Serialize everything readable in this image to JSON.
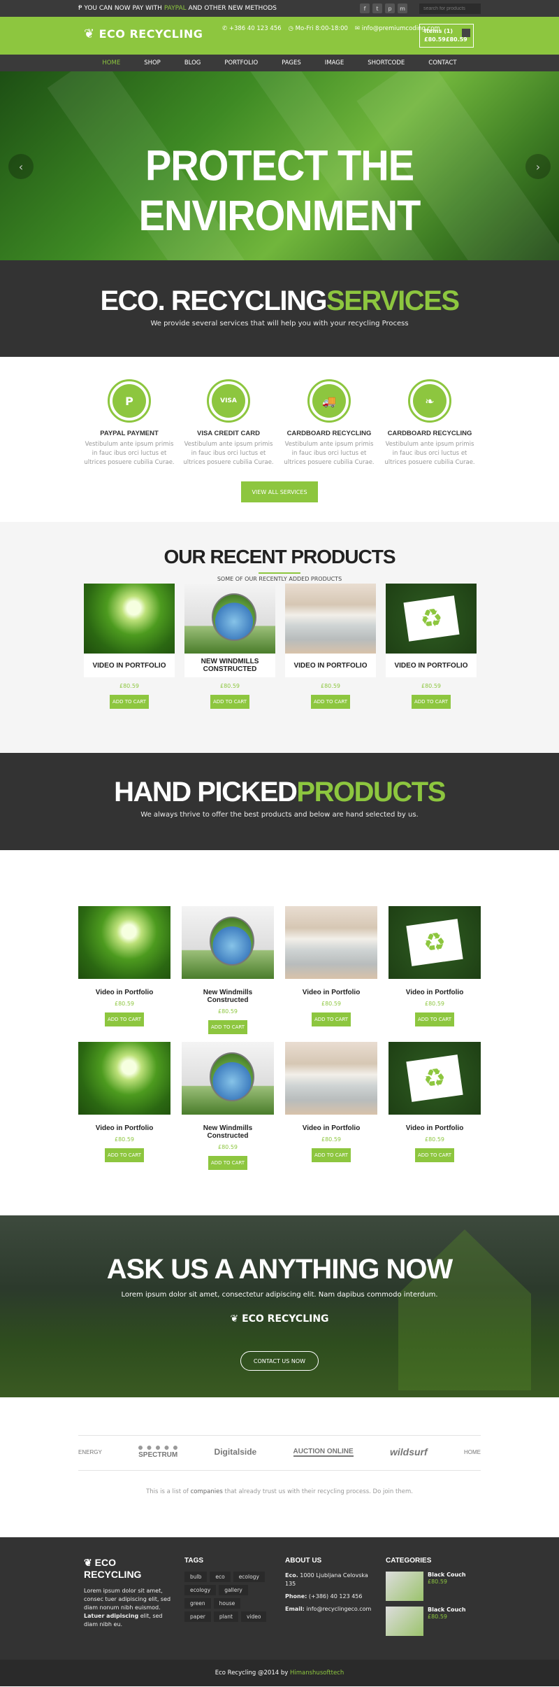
{
  "topbar": {
    "promo_prefix": "YOU CAN NOW PAY WITH",
    "promo_highlight": "PAYPAL",
    "promo_suffix": "AND OTHER NEW METHODS",
    "search_placeholder": "search for products",
    "social": [
      "f",
      "t",
      "p",
      "m"
    ]
  },
  "header": {
    "logo_text": "ECO RECYCLING",
    "phone": "+386 40 123 456",
    "hours": "Mo-Fri 8:00-18:00",
    "email": "info@premiumcoding.com",
    "cart_items": "Items (1)",
    "cart_total": "£80.59£80.59"
  },
  "nav": [
    "HOME",
    "SHOP",
    "BLOG",
    "PORTFOLIO",
    "PAGES",
    "IMAGE",
    "SHORTCODE",
    "CONTACT"
  ],
  "hero": {
    "title": "PROTECT THE ENVIRONMENT",
    "prev": "‹",
    "next": "›"
  },
  "services_band": {
    "title_white": "ECO. RECYCLING",
    "title_green": "SERVICES",
    "subtitle": "We provide several services that will help you with your recycling Process"
  },
  "services": [
    {
      "icon": "P",
      "title": "PAYPAL PAYMENT",
      "text": "Vestibulum ante ipsum primis in fauc ibus orci luctus et ultrices posuere cubilia Curae."
    },
    {
      "icon": "VISA",
      "title": "VISA CREDIT CARD",
      "text": "Vestibulum ante ipsum primis in fauc ibus orci luctus et ultrices posuere cubilia Curae."
    },
    {
      "icon": "🚚",
      "title": "CARDBOARD RECYCLING",
      "text": "Vestibulum ante ipsum primis in fauc ibus orci luctus et ultrices posuere cubilia Curae."
    },
    {
      "icon": "❧",
      "title": "CARDBOARD RECYCLING",
      "text": "Vestibulum ante ipsum primis in fauc ibus orci luctus et ultrices posuere cubilia Curae."
    }
  ],
  "services_button": "VIEW ALL SERVICES",
  "recent": {
    "title": "OUR RECENT PRODUCTS",
    "subtitle": "SOME OF OUR RECENTLY ADDED PRODUCTS",
    "products": [
      {
        "name": "VIDEO IN PORTFOLIO",
        "price": "£80.59",
        "button": "ADD TO CART"
      },
      {
        "name": "NEW WINDMILLS CONSTRUCTED",
        "price": "£80.59",
        "button": "ADD TO CART"
      },
      {
        "name": "VIDEO IN PORTFOLIO",
        "price": "£80.59",
        "button": "ADD TO CART"
      },
      {
        "name": "VIDEO IN PORTFOLIO",
        "price": "£80.59",
        "button": "ADD TO CART"
      }
    ]
  },
  "hand_band": {
    "title_white": "HAND PICKED",
    "title_green": "PRODUCTS",
    "subtitle": "We always thrive to offer the best products and below are hand selected by us."
  },
  "hand_products": [
    {
      "name": "Video in Portfolio",
      "price": "£80.59",
      "button": "ADD TO CART"
    },
    {
      "name": "New Windmills Constructed",
      "price": "£80.59",
      "button": "ADD TO CART"
    },
    {
      "name": "Video in Portfolio",
      "price": "£80.59",
      "button": "ADD TO CART"
    },
    {
      "name": "Video in Portfolio",
      "price": "£80.59",
      "button": "ADD TO CART"
    },
    {
      "name": "Video in Portfolio",
      "price": "£80.59",
      "button": "ADD TO CART"
    },
    {
      "name": "New Windmills Constructed",
      "price": "£80.59",
      "button": "ADD TO CART"
    },
    {
      "name": "Video in Portfolio",
      "price": "£80.59",
      "button": "ADD TO CART"
    },
    {
      "name": "Video in Portfolio",
      "price": "£80.59",
      "button": "ADD TO CART"
    }
  ],
  "ask": {
    "title": "ASK US A ANYTHING NOW",
    "text": "Lorem ipsum dolor sit amet, consectetur adipiscing elit. Nam dapibus commodo interdum.",
    "logo": "ECO RECYCLING",
    "button": "CONTACT US NOW"
  },
  "partners": {
    "logos": [
      "ENERGY",
      "SPECTRUM",
      "Digitalside",
      "AUCTION ONLINE",
      "wildsurf",
      "HOME"
    ],
    "note_prefix": "This is a list of",
    "note_bold": "companies",
    "note_suffix": "that already trust us with their recycling process. Do join them."
  },
  "footer": {
    "logo": "ECO RECYCLING",
    "about_a": "Lorem ipsum dolor sit amet, consec tuer adipiscing elit, sed diam nonum nibh euismod.",
    "about_bold": "Latuer adipiscing",
    "about_b": "elit, sed diam nibh eu.",
    "tags_title": "TAGS",
    "tags": [
      "bulb",
      "eco",
      "ecology",
      "ecology",
      "gallery",
      "green",
      "house",
      "paper",
      "plant",
      "video"
    ],
    "about_title": "ABOUT US",
    "address_label": "Eco.",
    "address": "1000 Ljubljana Celovska 135",
    "phone_label": "Phone:",
    "phone": "(+386) 40 123 456",
    "email_label": "Email:",
    "email": "info@recyclingeco.com",
    "categories_title": "CATEGORIES",
    "categories": [
      {
        "name": "Black Couch",
        "price": "£80.59"
      },
      {
        "name": "Black Couch",
        "price": "£80.59"
      }
    ]
  },
  "copyright_prefix": "Eco Recycling @2014 by",
  "copyright_link": "Himanshusofttech",
  "colors": {
    "accent": "#8dc63f",
    "dark": "#333333"
  }
}
